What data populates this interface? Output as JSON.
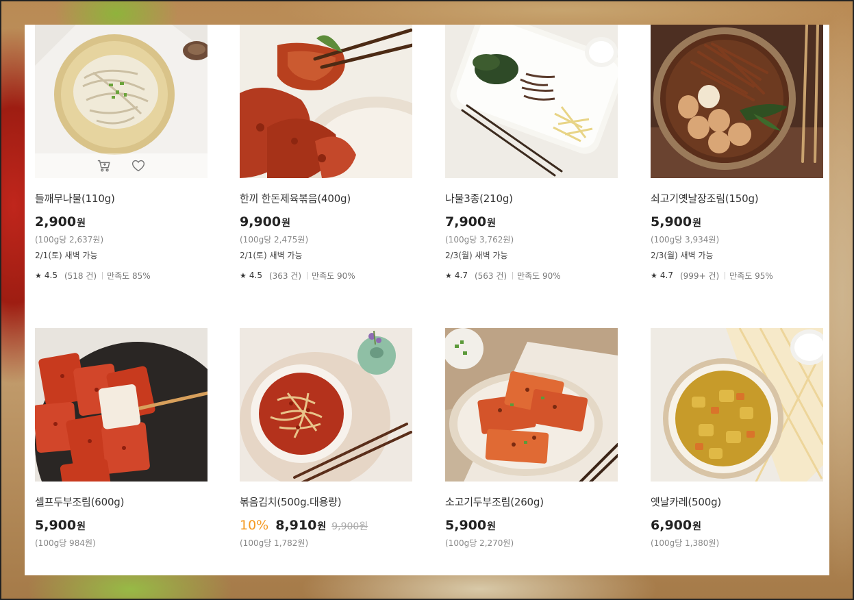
{
  "colors": {
    "discount": "#f59a23",
    "price": "#222222",
    "muted": "#888888"
  },
  "icons": {
    "cart": "cart-icon",
    "heart": "heart-icon",
    "star": "star-icon"
  },
  "currency": "원",
  "products": [
    {
      "name": "들깨무나물(110g)",
      "price": "2,900",
      "unit_price": "(100g당 2,637원)",
      "delivery": "2/1(토) 새벽 가능",
      "rating": "4.5",
      "reviews": "(518 건)",
      "satisfaction": "만족도 85%",
      "image": "radish-salad"
    },
    {
      "name": "한끼 한돈제육볶음(400g)",
      "price": "9,900",
      "unit_price": "(100g당 2,475원)",
      "delivery": "2/1(토) 새벽 가능",
      "rating": "4.5",
      "reviews": "(363 건)",
      "satisfaction": "만족도 90%",
      "image": "spicy-pork"
    },
    {
      "name": "나물3종(210g)",
      "price": "7,900",
      "unit_price": "(100g당 3,762원)",
      "delivery": "2/3(월) 새벽 가능",
      "rating": "4.7",
      "reviews": "(563 건)",
      "satisfaction": "만족도 90%",
      "image": "three-namul"
    },
    {
      "name": "쇠고기옛날장조림(150g)",
      "price": "5,900",
      "unit_price": "(100g당 3,934원)",
      "delivery": "2/3(월) 새벽 가능",
      "rating": "4.7",
      "reviews": "(999+ 건)",
      "satisfaction": "만족도 95%",
      "image": "beef-jangjorim"
    },
    {
      "name": "셀프두부조림(600g)",
      "price": "5,900",
      "unit_price": "(100g당 984원)",
      "delivery": "",
      "image": "braised-tofu"
    },
    {
      "name": "볶음김치(500g.대용량)",
      "discount": "10%",
      "price": "8,910",
      "original_price": "9,900원",
      "unit_price": "(100g당 1,782원)",
      "delivery": "",
      "image": "stir-fried-kimchi"
    },
    {
      "name": "소고기두부조림(260g)",
      "price": "5,900",
      "unit_price": "(100g당 2,270원)",
      "delivery": "",
      "image": "beef-tofu"
    },
    {
      "name": "옛날카레(500g)",
      "price": "6,900",
      "unit_price": "(100g당 1,380원)",
      "delivery": "",
      "image": "curry"
    }
  ]
}
